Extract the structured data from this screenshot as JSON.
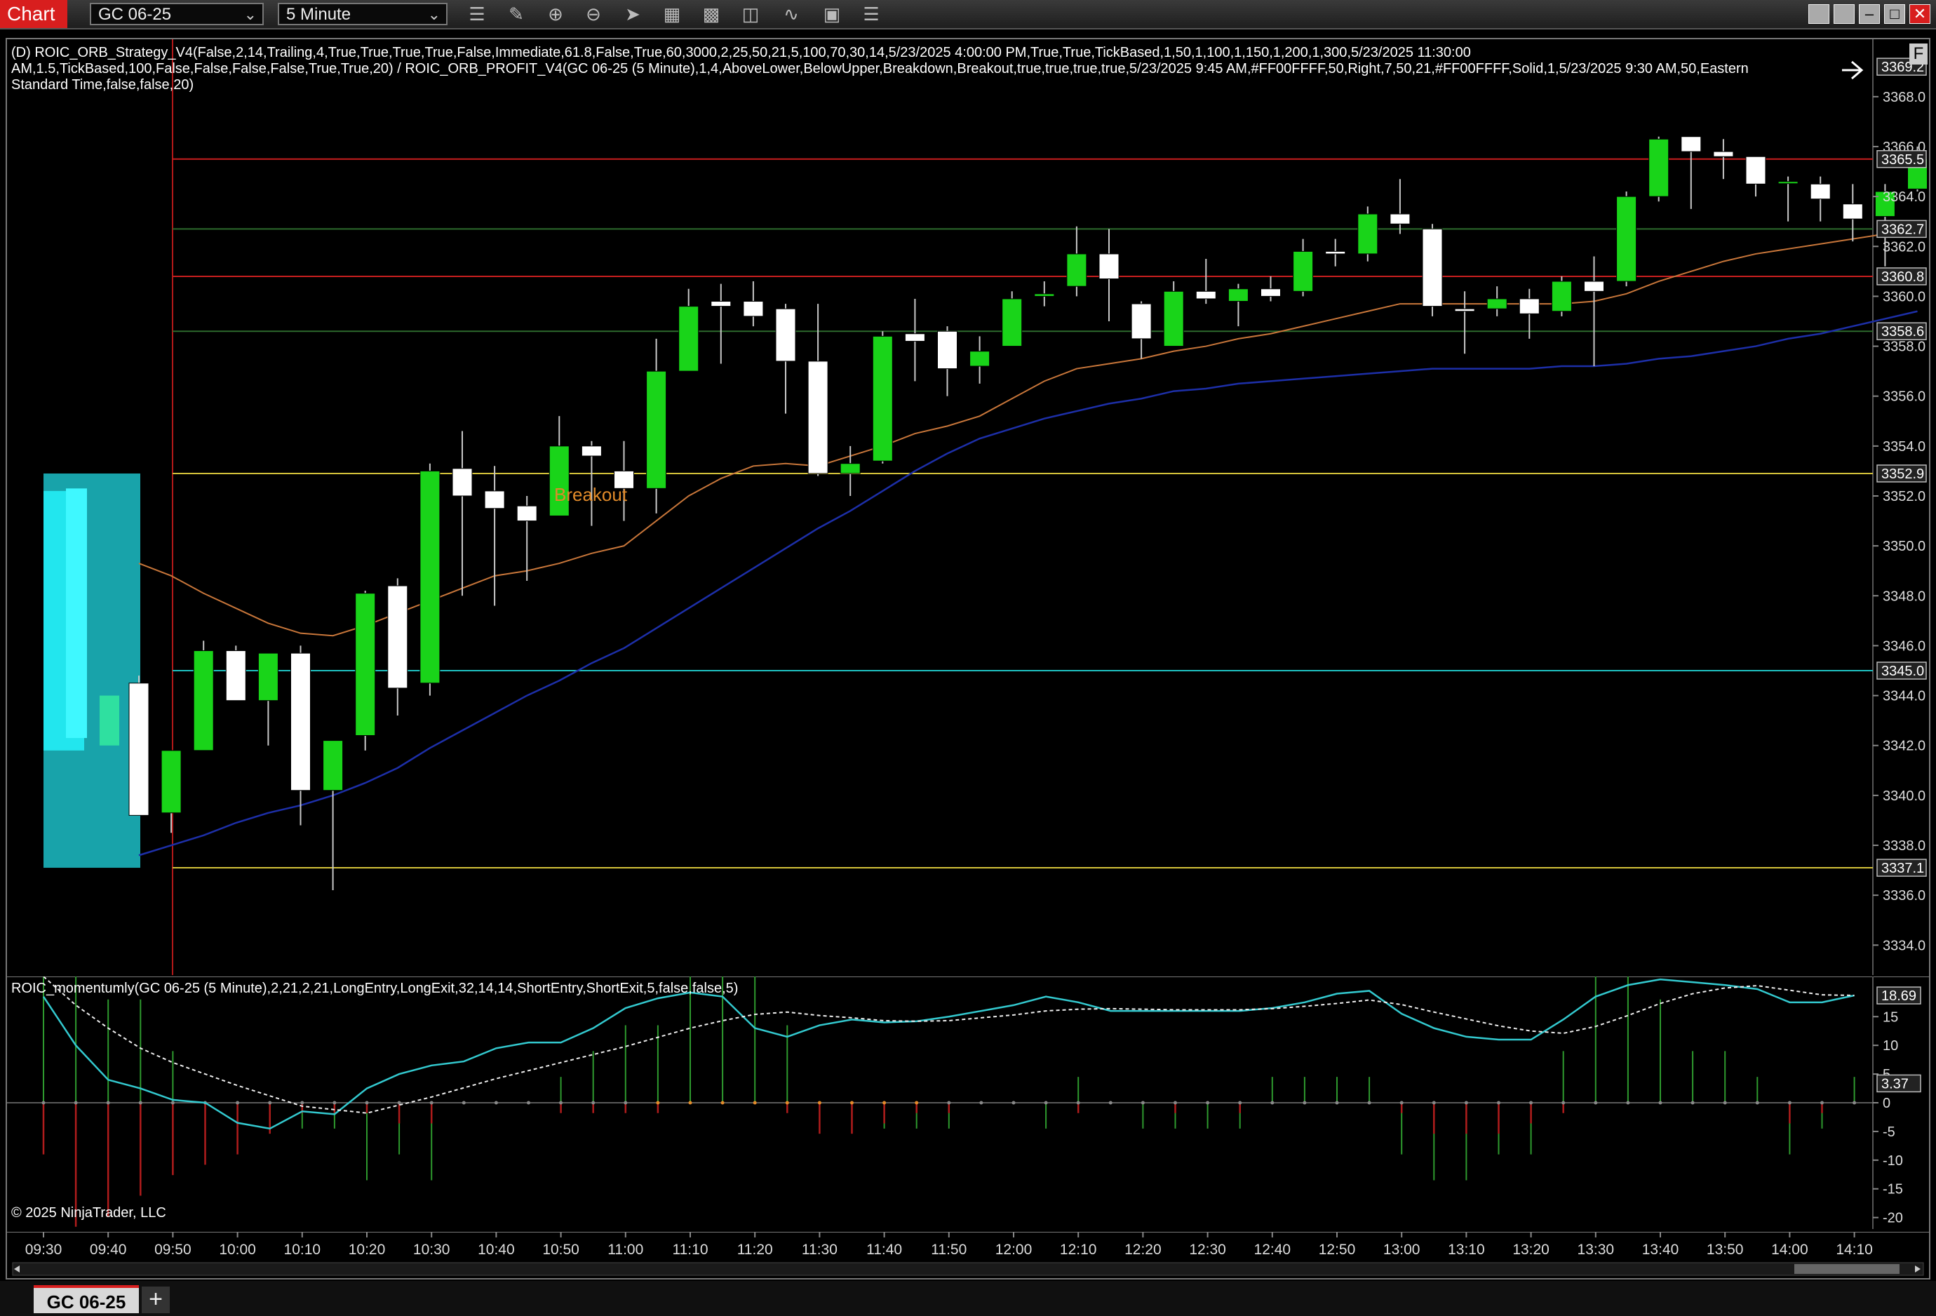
{
  "app": {
    "title": "Chart"
  },
  "toolbar": {
    "instrument": "GC 06-25",
    "interval": "5 Minute",
    "icons": [
      "bars-type-icon",
      "drawing-pencil-icon",
      "zoom-in-icon",
      "zoom-out-icon",
      "pointer-icon",
      "data-box-icon",
      "properties-icon",
      "indicators-icon",
      "strategies-icon",
      "chart-trader-icon",
      "list-icon"
    ]
  },
  "window": {
    "f_label": "F"
  },
  "labels": {
    "strategy_line1": "(D) ROIC_ORB_Strategy_V4(False,2,14,Trailing,4,True,True,True,True,False,Immediate,61.8,False,True,60,3000,2,25,50,21,5,100,70,30,14,5/23/2025 4:00:00 PM,True,True,TickBased,1,50,1,100,1,150,1,200,1,300,5/23/2025 11:30:00",
    "strategy_line2": "AM,1.5,TickBased,100,False,False,False,False,True,True,20) / ROIC_ORB_PROFIT_V4(GC 06-25 (5 Minute),1,4,AboveLower,BelowUpper,Breakdown,Breakout,true,true,true,true,5/23/2025 9:45 AM,#FF00FFFF,50,Right,7,50,21,#FF00FFFF,Solid,1,5/23/2025 9:30 AM,50,Eastern",
    "strategy_line3": "Standard Time,false,false,20)",
    "momentum": "ROIC_momentumly(GC 06-25 (5 Minute),2,21,2,21,LongEntry,LongExit,32,14,14,ShortEntry,ShortExit,5,false,false,5)",
    "copyright": "© 2025 NinjaTrader, LLC",
    "breakout": "Breakout"
  },
  "tabs": {
    "active": "GC 06-25",
    "add": "+"
  },
  "chart_data": {
    "type": "candlestick",
    "instrument": "GC 06-25",
    "interval": "5 Minute",
    "candles": [
      {
        "o": 3344.5,
        "h": 3344.8,
        "l": 3340.5,
        "c": 3339.2
      },
      {
        "o": 3339.3,
        "h": 3340.5,
        "l": 3338.5,
        "c": 3341.8
      },
      {
        "o": 3341.8,
        "h": 3346.2,
        "l": 3344.0,
        "c": 3345.8
      },
      {
        "o": 3345.8,
        "h": 3346.0,
        "l": 3343.8,
        "c": 3343.8
      },
      {
        "o": 3343.8,
        "h": 3345.7,
        "l": 3342.0,
        "c": 3345.7
      },
      {
        "o": 3345.7,
        "h": 3346.0,
        "l": 3338.8,
        "c": 3340.2
      },
      {
        "o": 3340.2,
        "h": 3342.2,
        "l": 3336.2,
        "c": 3342.2
      },
      {
        "o": 3342.4,
        "h": 3348.2,
        "l": 3341.8,
        "c": 3348.1
      },
      {
        "o": 3348.4,
        "h": 3348.7,
        "l": 3343.2,
        "c": 3344.3
      },
      {
        "o": 3344.5,
        "h": 3353.3,
        "l": 3344.0,
        "c": 3353.0
      },
      {
        "o": 3353.1,
        "h": 3354.6,
        "l": 3348.0,
        "c": 3352.0
      },
      {
        "o": 3352.2,
        "h": 3353.2,
        "l": 3347.6,
        "c": 3351.5
      },
      {
        "o": 3351.6,
        "h": 3352.0,
        "l": 3348.6,
        "c": 3351.0
      },
      {
        "o": 3351.2,
        "h": 3355.2,
        "l": 3351.2,
        "c": 3354.0
      },
      {
        "o": 3354.0,
        "h": 3354.2,
        "l": 3350.8,
        "c": 3353.6
      },
      {
        "o": 3353.0,
        "h": 3354.2,
        "l": 3351.0,
        "c": 3352.3
      },
      {
        "o": 3352.3,
        "h": 3358.3,
        "l": 3351.3,
        "c": 3357.0
      },
      {
        "o": 3357.0,
        "h": 3360.3,
        "l": 3357.0,
        "c": 3359.6
      },
      {
        "o": 3359.8,
        "h": 3360.5,
        "l": 3357.3,
        "c": 3359.6
      },
      {
        "o": 3359.8,
        "h": 3360.6,
        "l": 3358.8,
        "c": 3359.2
      },
      {
        "o": 3359.5,
        "h": 3359.7,
        "l": 3355.3,
        "c": 3357.4
      },
      {
        "o": 3357.4,
        "h": 3359.7,
        "l": 3352.8,
        "c": 3352.9
      },
      {
        "o": 3352.9,
        "h": 3354.0,
        "l": 3352.0,
        "c": 3353.3
      },
      {
        "o": 3353.4,
        "h": 3358.6,
        "l": 3353.3,
        "c": 3358.4
      },
      {
        "o": 3358.5,
        "h": 3359.9,
        "l": 3356.6,
        "c": 3358.2
      },
      {
        "o": 3358.6,
        "h": 3358.8,
        "l": 3356.0,
        "c": 3357.1
      },
      {
        "o": 3357.2,
        "h": 3358.4,
        "l": 3356.5,
        "c": 3357.8
      },
      {
        "o": 3358.0,
        "h": 3360.2,
        "l": 3358.0,
        "c": 3359.9
      },
      {
        "o": 3360.0,
        "h": 3360.6,
        "l": 3359.6,
        "c": 3360.1
      },
      {
        "o": 3360.4,
        "h": 3362.8,
        "l": 3360.0,
        "c": 3361.7
      },
      {
        "o": 3361.7,
        "h": 3362.7,
        "l": 3359.0,
        "c": 3360.7
      },
      {
        "o": 3359.7,
        "h": 3359.8,
        "l": 3357.5,
        "c": 3358.3
      },
      {
        "o": 3358.0,
        "h": 3360.6,
        "l": 3358.0,
        "c": 3360.2
      },
      {
        "o": 3360.2,
        "h": 3361.5,
        "l": 3359.7,
        "c": 3359.9
      },
      {
        "o": 3359.8,
        "h": 3360.5,
        "l": 3358.8,
        "c": 3360.3
      },
      {
        "o": 3360.3,
        "h": 3360.8,
        "l": 3359.8,
        "c": 3360.0
      },
      {
        "o": 3360.2,
        "h": 3362.3,
        "l": 3360.0,
        "c": 3361.8
      },
      {
        "o": 3361.8,
        "h": 3362.3,
        "l": 3361.2,
        "c": 3361.7
      },
      {
        "o": 3361.7,
        "h": 3363.6,
        "l": 3361.4,
        "c": 3363.3
      },
      {
        "o": 3363.3,
        "h": 3364.7,
        "l": 3362.5,
        "c": 3362.9
      },
      {
        "o": 3362.7,
        "h": 3362.9,
        "l": 3359.2,
        "c": 3359.6
      },
      {
        "o": 3359.5,
        "h": 3360.2,
        "l": 3357.7,
        "c": 3359.4
      },
      {
        "o": 3359.5,
        "h": 3360.4,
        "l": 3359.2,
        "c": 3359.9
      },
      {
        "o": 3359.9,
        "h": 3360.3,
        "l": 3358.3,
        "c": 3359.3
      },
      {
        "o": 3359.4,
        "h": 3360.8,
        "l": 3359.2,
        "c": 3360.6
      },
      {
        "o": 3360.6,
        "h": 3361.6,
        "l": 3357.2,
        "c": 3360.2
      },
      {
        "o": 3360.6,
        "h": 3364.2,
        "l": 3360.4,
        "c": 3364.0
      },
      {
        "o": 3364.0,
        "h": 3366.4,
        "l": 3363.8,
        "c": 3366.3
      },
      {
        "o": 3366.4,
        "h": 3366.4,
        "l": 3363.5,
        "c": 3365.8
      },
      {
        "o": 3365.8,
        "h": 3366.3,
        "l": 3364.7,
        "c": 3365.6
      },
      {
        "o": 3365.6,
        "h": 3365.6,
        "l": 3364.0,
        "c": 3364.5
      },
      {
        "o": 3364.6,
        "h": 3364.8,
        "l": 3363.0,
        "c": 3364.6
      },
      {
        "o": 3364.5,
        "h": 3364.8,
        "l": 3363.0,
        "c": 3363.9
      },
      {
        "o": 3363.7,
        "h": 3364.5,
        "l": 3362.2,
        "c": 3363.1
      },
      {
        "o": 3363.2,
        "h": 3364.5,
        "l": 3361.2,
        "c": 3364.2
      },
      {
        "o": 3364.3,
        "h": 3366.0,
        "l": 3364.2,
        "c": 3365.5
      }
    ],
    "ema_orange": [
      3349.3,
      3348.8,
      3348.1,
      3347.5,
      3346.9,
      3346.5,
      3346.4,
      3346.8,
      3347.3,
      3347.8,
      3348.3,
      3348.8,
      3349.0,
      3349.3,
      3349.7,
      3350.0,
      3351.0,
      3352.0,
      3352.7,
      3353.2,
      3353.3,
      3353.2,
      3353.6,
      3354.0,
      3354.5,
      3354.8,
      3355.2,
      3355.9,
      3356.6,
      3357.1,
      3357.3,
      3357.5,
      3357.8,
      3358.0,
      3358.3,
      3358.5,
      3358.8,
      3359.1,
      3359.4,
      3359.7,
      3359.7,
      3359.7,
      3359.7,
      3359.7,
      3359.7,
      3359.8,
      3360.1,
      3360.6,
      3361.0,
      3361.4,
      3361.7,
      3361.9,
      3362.1,
      3362.3,
      3362.5,
      3362.9
    ],
    "ema_blue": [
      3337.6,
      3338.0,
      3338.4,
      3338.9,
      3339.3,
      3339.6,
      3340.0,
      3340.5,
      3341.1,
      3341.9,
      3342.6,
      3343.3,
      3344.0,
      3344.6,
      3345.3,
      3345.9,
      3346.7,
      3347.5,
      3348.3,
      3349.1,
      3349.9,
      3350.7,
      3351.4,
      3352.2,
      3353.0,
      3353.7,
      3354.3,
      3354.7,
      3355.1,
      3355.4,
      3355.7,
      3355.9,
      3356.2,
      3356.3,
      3356.5,
      3356.6,
      3356.7,
      3356.8,
      3356.9,
      3357.0,
      3357.1,
      3357.1,
      3357.1,
      3357.1,
      3357.2,
      3357.2,
      3357.3,
      3357.5,
      3357.6,
      3357.8,
      3358.0,
      3358.3,
      3358.5,
      3358.8,
      3359.1,
      3359.4
    ],
    "horizontal_lines": [
      {
        "price": 3365.5,
        "color": "#c81e1e"
      },
      {
        "price": 3362.7,
        "color": "#2d6b2d"
      },
      {
        "price": 3360.8,
        "color": "#c81e1e"
      },
      {
        "price": 3358.6,
        "color": "#2d6b2d"
      },
      {
        "price": 3352.9,
        "color": "#d4c23a"
      },
      {
        "price": 3345.0,
        "color": "#1fc0c0"
      },
      {
        "price": 3337.1,
        "color": "#d4c23a"
      }
    ],
    "price_ticks": [
      "3368.0",
      "3366.0",
      "3364.0",
      "3362.0",
      "3360.0",
      "3358.0",
      "3356.0",
      "3354.0",
      "3352.0",
      "3350.0",
      "3348.0",
      "3346.0",
      "3344.0",
      "3342.0",
      "3340.0",
      "3338.0",
      "3336.0",
      "3334.0"
    ],
    "price_markers": [
      {
        "label": "3369.2",
        "price": 3369.2,
        "style": "last"
      },
      {
        "label": "3365.5",
        "price": 3365.5,
        "style": "box"
      },
      {
        "label": "3362.7",
        "price": 3362.7,
        "style": "box"
      },
      {
        "label": "3360.8",
        "price": 3360.8,
        "style": "box"
      },
      {
        "label": "3358.6",
        "price": 3358.6,
        "style": "box"
      },
      {
        "label": "3352.9",
        "price": 3352.9,
        "style": "box"
      },
      {
        "label": "3345.0",
        "price": 3345.0,
        "style": "box"
      },
      {
        "label": "3337.1",
        "price": 3337.1,
        "style": "box"
      }
    ],
    "price_range": [
      3332.8,
      3370.3
    ],
    "orb_range": {
      "high": 3352.9,
      "low": 3337.1
    },
    "time_ticks": [
      "09:30",
      "09:40",
      "09:50",
      "10:00",
      "10:10",
      "10:20",
      "10:30",
      "10:40",
      "10:50",
      "11:00",
      "11:10",
      "11:20",
      "11:30",
      "11:40",
      "11:50",
      "12:00",
      "12:10",
      "12:20",
      "12:30",
      "12:40",
      "12:50",
      "13:00",
      "13:10",
      "13:20",
      "13:30",
      "13:40",
      "13:50",
      "14:00",
      "14:10"
    ],
    "momentum": {
      "range": [
        -22,
        22
      ],
      "ticks": [
        "15",
        "10",
        "5",
        "0",
        "-5",
        "-10",
        "-15",
        "-20"
      ],
      "markers": [
        {
          "label": "18.69",
          "value": 18.69
        },
        {
          "label": "3.37",
          "value": 3.37
        }
      ],
      "fast": [
        18.5,
        10,
        4,
        2.5,
        0.5,
        0,
        -3.5,
        -4.5,
        -1.5,
        -2,
        2.5,
        5,
        6.5,
        7.2,
        9.5,
        10.5,
        10.5,
        13,
        16.5,
        18.2,
        19.2,
        18.5,
        13,
        11.5,
        13.5,
        14.5,
        14,
        14.2,
        15,
        16,
        17,
        18.5,
        17.5,
        16,
        16,
        16,
        16,
        16,
        16.5,
        17.5,
        19,
        19.5,
        15.5,
        13,
        11.5,
        11,
        11,
        14.5,
        18.5,
        20.5,
        21.5,
        21,
        20.5,
        19.8,
        17.5,
        17.5,
        18.7
      ],
      "slow": [
        22,
        17,
        13,
        9.5,
        7,
        5,
        3,
        1.2,
        -0.6,
        -1.2,
        -1.8,
        -0.4,
        1,
        2.6,
        4.2,
        5.6,
        7,
        8.4,
        9.8,
        11.4,
        13,
        14.3,
        15.4,
        15.8,
        15.2,
        14.8,
        14.3,
        14.2,
        14.3,
        14.8,
        15.3,
        16,
        16.3,
        16.4,
        16.3,
        16.2,
        16.2,
        16.2,
        16.4,
        16.8,
        17.3,
        17.9,
        17.1,
        15.8,
        14.6,
        13.4,
        12.5,
        12.1,
        13.3,
        15.2,
        17.3,
        19,
        20,
        20.4,
        19.6,
        18.8,
        18.7
      ],
      "hist": [
        11,
        9,
        4,
        4,
        2,
        0,
        0,
        -1,
        -1,
        -1,
        -3,
        -2,
        -3,
        0,
        0,
        0,
        1,
        2,
        3,
        3,
        5,
        5,
        5,
        3,
        0,
        -1,
        -1,
        -1,
        -1,
        0,
        0,
        -1,
        1,
        0,
        -1,
        -1,
        -1,
        -1,
        1,
        1,
        1,
        1,
        -2,
        -3,
        -3,
        -2,
        -2,
        2,
        5,
        5,
        4,
        2,
        2,
        1,
        -2,
        -1,
        1
      ],
      "hist_neg": [
        -5,
        -12,
        -11,
        -9,
        -7,
        -6,
        -5,
        -3,
        -1,
        -1,
        -1,
        -2,
        -2,
        0,
        0,
        0,
        -1,
        -1,
        -1,
        -1,
        0,
        0,
        0,
        -1,
        -3,
        -3,
        -2,
        -1,
        -1,
        0,
        0,
        0,
        -1,
        0,
        0,
        -1,
        0,
        -1,
        0,
        0,
        0,
        0,
        -1,
        -3,
        -3,
        -3,
        -2,
        -1,
        0,
        0,
        0,
        0,
        0,
        0,
        -2,
        -1,
        0
      ]
    }
  }
}
